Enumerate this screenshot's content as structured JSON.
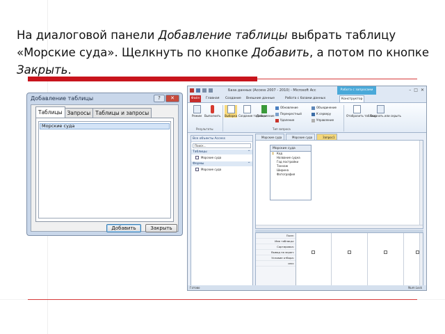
{
  "slide": {
    "instruction_part1": "На диалоговой панели ",
    "instruction_em1": "Добавление таблицы",
    "instruction_part2": " выбрать таблицу «Морские суда». Щелкнуть по кнопке ",
    "instruction_em2": "Добавить",
    "instruction_part3": ", а потом по кнопке ",
    "instruction_em3": "Закрыть",
    "instruction_part4": "."
  },
  "dialog": {
    "title": "Добавление таблицы",
    "close_glyph": "✕",
    "help_glyph": "?",
    "tabs": [
      "Таблицы",
      "Запросы",
      "Таблицы и запросы"
    ],
    "active_tab": 0,
    "list_items": [
      "Морские суда"
    ],
    "selected_item": 0,
    "add_button": "Добавить",
    "close_button": "Закрыть"
  },
  "access": {
    "title": "База данных (Access 2007 - 2010) - Microsoft Acc",
    "context_tab": "Работа с запросами",
    "window_controls": [
      "–",
      "□",
      "✕"
    ],
    "ribbon_tabs": [
      "Файл",
      "Главная",
      "Создание",
      "Внешние данные",
      "Работа с базами данных",
      "Конструктор"
    ],
    "active_ribbon_tab": 5,
    "ribbon": {
      "results_group": "Результаты",
      "run_label": "Выполнить",
      "view_label": "Режим",
      "query_type_group": "Тип запроса",
      "select_label": "Выборка",
      "make_table_label": "Создание таблицы",
      "add_label": "Добавление",
      "update_label": "Обновление",
      "crosstab_label": "Перекрестный",
      "delete_label": "Удаление",
      "union_label": "Объединение",
      "passthrough_label": "К серверу",
      "ddl_label": "Управление",
      "show_table_label": "Отобразить таблицу",
      "show_hide_label": "Показать или скрыть"
    },
    "nav": {
      "header": "Все объекты Access",
      "search_placeholder": "Поиск...",
      "group_tables": "Таблицы",
      "tables": [
        "Морские суда"
      ],
      "group_forms": "Формы",
      "forms": [
        "Морские суда"
      ]
    },
    "doc_tabs": [
      "Морские суда",
      "Морские суда",
      "Запрос1"
    ],
    "active_doc_tab": 2,
    "table_box": {
      "title": "Морские суда",
      "fields": [
        "Код",
        "Название судна",
        "Год постройки",
        "Тоннаж",
        "Ширина",
        "Фотография"
      ]
    },
    "grid_labels": [
      "Поле:",
      "Имя таблицы:",
      "Сортировка:",
      "Вывод на экран:",
      "Условие отбора:",
      "или:"
    ],
    "status": "Готово",
    "zoom_text": "Num Lock"
  },
  "colors": {
    "accent_red": "#c8141c",
    "dialog_frame": "#c9d7ea",
    "context_tab": "#4aa9d9",
    "active_doc_tab": "#f4d77a"
  }
}
